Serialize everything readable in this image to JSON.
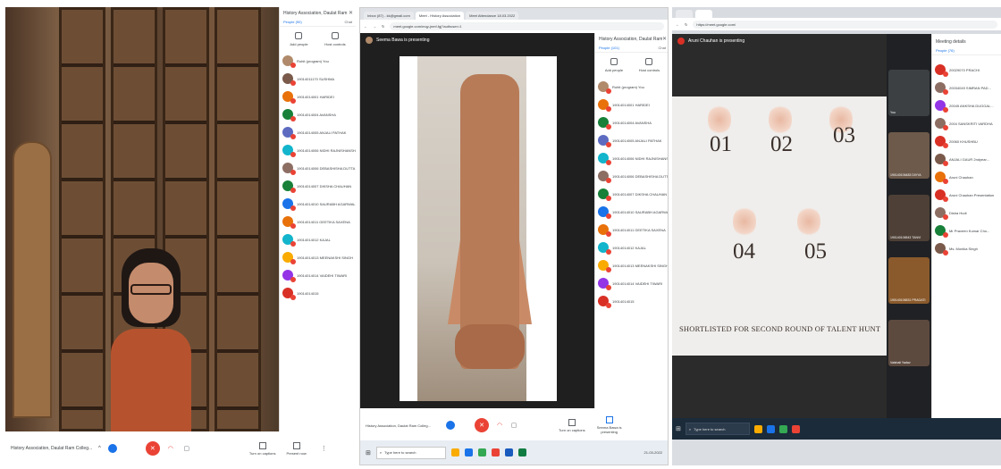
{
  "panel1": {
    "people_title": "History Association, Daulat Ram Co...",
    "tabs": [
      "People (90)",
      "Chat"
    ],
    "actions": [
      "Add people",
      "Host controls"
    ],
    "participants": [
      {
        "name": "Rohit (program) You",
        "color": "#b08a6a"
      },
      {
        "name": "19014011170 SUSHMA",
        "color": "#7a5a4a"
      },
      {
        "name": "19014014001 HARIDEI",
        "color": "#e8710a"
      },
      {
        "name": "19014014004 AVANSHA",
        "color": "#188038"
      },
      {
        "name": "19014014005 ANJALI PATHAK",
        "color": "#5c6bc0"
      },
      {
        "name": "19014014006 NIDHI RAJNISHANSHA",
        "color": "#12b5cb"
      },
      {
        "name": "19014014006 DEBASHISHA DUTTA",
        "color": "#8d6e63"
      },
      {
        "name": "19014014007 DIKSHA CHAUHAN",
        "color": "#188038"
      },
      {
        "name": "19014014010 SAURABH AGARWAL",
        "color": "#1a73e8"
      },
      {
        "name": "19014014011 GEETIKA SAXENA",
        "color": "#e8710a"
      },
      {
        "name": "19014014012 KAJAL",
        "color": "#12b5cb"
      },
      {
        "name": "19014014013 MEENAKSHI SINGH",
        "color": "#f9ab00"
      },
      {
        "name": "19014014014 VAIDEHI TIWARI",
        "color": "#9334e6"
      },
      {
        "name": "19014014015",
        "color": "#d93025"
      }
    ],
    "meeting_name": "History Association, Daulat Ram Colleg...",
    "controls": [
      "Turn on captions",
      "Present now"
    ]
  },
  "panel2": {
    "tabs": [
      "Inbox (87) - kk@gmail.com",
      "Meet - History Association",
      "Meet Attendance 18.03.2022"
    ],
    "url": "meet.google.com/mqy-jnmf-fgj?authuser=1",
    "presenter": "Seema Bawa is presenting",
    "people_title": "History Association, Daulat Ram Co...",
    "tabs_people": [
      "People (101)",
      "Chat"
    ],
    "actions": [
      "Add people",
      "Host controls"
    ],
    "participants": [
      {
        "name": "Rohit (program) You",
        "color": "#b08a6a"
      },
      {
        "name": "19014014001 HARIDEI",
        "color": "#e8710a"
      },
      {
        "name": "19014014004 AVANSHA",
        "color": "#188038"
      },
      {
        "name": "19014014005 ANJALI PATHAK",
        "color": "#5c6bc0"
      },
      {
        "name": "19014014006 NIDHI RAJNISHANSHA",
        "color": "#12b5cb"
      },
      {
        "name": "19014014006 DEBASHISHA DUTTA",
        "color": "#8d6e63"
      },
      {
        "name": "19014014007 DIKSHA CHAUHAN",
        "color": "#188038"
      },
      {
        "name": "19014014010 SAURABH AGARWAL",
        "color": "#1a73e8"
      },
      {
        "name": "19014014011 GEETIKA SAXENA",
        "color": "#e8710a"
      },
      {
        "name": "19014014012 KAJAL",
        "color": "#12b5cb"
      },
      {
        "name": "19014014013 MEENAKSHI SINGH",
        "color": "#f9ab00"
      },
      {
        "name": "19014014014 VAIDEHI TIWARI",
        "color": "#9334e6"
      },
      {
        "name": "19014014015",
        "color": "#d93025"
      }
    ],
    "meeting_name": "History Association, Daulat Ram Colleg...",
    "controls": [
      "Turn on captions",
      "Seema Bawa is presenting"
    ],
    "taskbar_search": "Type here to search",
    "clock": "21-03-2022"
  },
  "panel3": {
    "presenter": "Aruni Chauhan is presenting",
    "url": "https://meet.google.com/",
    "numbers": [
      "01",
      "02",
      "03",
      "04",
      "05"
    ],
    "slide_text": "SHORTLISTED FOR SECOND ROUND OF TALENT HUNT",
    "tile_labels": [
      "You",
      "190140106483 DIVYA",
      "190140106543 TANVI",
      "190140106531 PRAGATI",
      "Vaishali Yadav"
    ],
    "meeting_details": "Meeting details",
    "people_tab": "People (76)",
    "participants": [
      {
        "name": "20029070 PRACHI",
        "color": "#d93025"
      },
      {
        "name": "20034049 SIMRAN PAD...",
        "color": "#8d6e63"
      },
      {
        "name": "20045 ANKSHA DUGGAL...",
        "color": "#9334e6"
      },
      {
        "name": "2004 SANSKRITI VARDHA",
        "color": "#8d6e63"
      },
      {
        "name": "20060 KHUSHBU",
        "color": "#d93025"
      },
      {
        "name": "ANJALI GAUR 2ndyear...",
        "color": "#7a5a4a"
      },
      {
        "name": "Aruni Chauhan",
        "color": "#e8710a"
      },
      {
        "name": "Aruni Chauhan Presentation",
        "color": "#d93025"
      },
      {
        "name": "Disha Hudi",
        "color": "#8d6e63"
      },
      {
        "name": "Mr Praveen Kumar Cho...",
        "color": "#188038"
      },
      {
        "name": "Ms. Monika Singh",
        "color": "#7a5a4a"
      }
    ],
    "taskbar_search": "Type here to search"
  }
}
